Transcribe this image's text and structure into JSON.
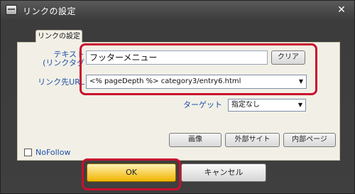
{
  "window": {
    "title": "リンクの設定",
    "close_glyph": "✕"
  },
  "tab": {
    "label": "リンクの設定"
  },
  "form": {
    "text_label": "テキスト\n(リンクタグ",
    "text_value": "フッターメニュー",
    "clear_label": "クリア",
    "url_label": "リンク先URL",
    "url_value": "<% pageDepth %> category3/entry6.html",
    "target_label": "ターゲット",
    "target_value": "指定なし",
    "dropdown_glyph": "▼"
  },
  "source_buttons": {
    "image": "画像",
    "external": "外部サイト",
    "internal": "内部ページ"
  },
  "nofollow": {
    "label": "NoFollow",
    "checked": false
  },
  "footer": {
    "ok_label": "OK",
    "cancel_label": "キャンセル"
  },
  "colors": {
    "highlight": "#c8102e",
    "label_blue": "#1e4fa8",
    "ok_gold": "#f8d560"
  }
}
